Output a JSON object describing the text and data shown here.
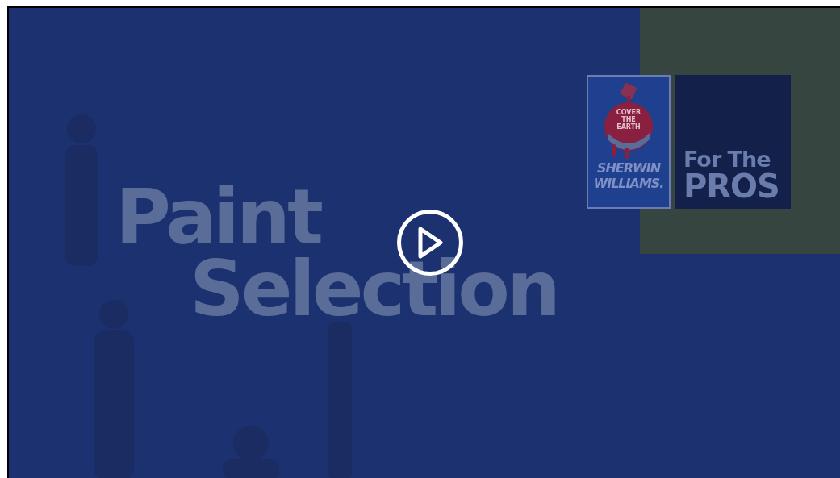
{
  "video": {
    "title_lines": [
      "Paint",
      "Selection"
    ],
    "logo": {
      "slogan": "COVER THE EARTH",
      "brand_lines": [
        "SHERWIN",
        "WILLIAMS."
      ]
    },
    "tagline_lines": [
      "For The",
      "PROS"
    ]
  }
}
